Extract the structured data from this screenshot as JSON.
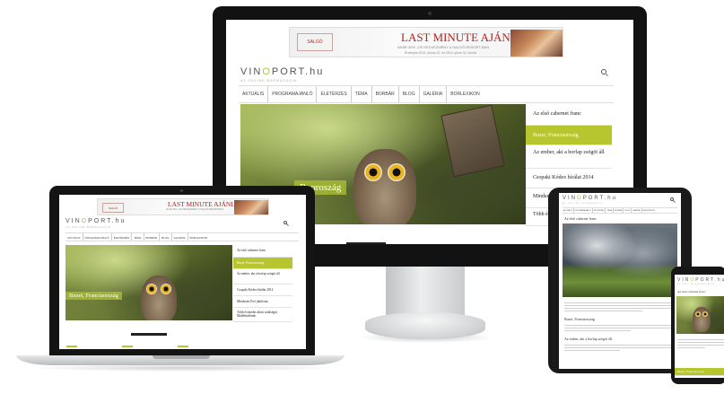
{
  "site": {
    "logo_left": "VIN",
    "logo_o": "O",
    "logo_right": "PORT.hu",
    "tagline": "AZ ONLINE BORMAGAZIN",
    "brand_color": "#b7c52e"
  },
  "banner": {
    "title": "LAST MINUTE AJÁNLAT",
    "subtitle": "AKÁR 30% -OS KEDVEZMÉNY A SALGÓ RESORT-BAN",
    "small": "Érvényes 2014. június 20. és 2014. július 31. között",
    "logo_text": "SALGÓ RESORT"
  },
  "nav": [
    "AKTUÁLIS",
    "PROGRAMAJÁNLÓ",
    "ÉLETÉRZÉS",
    "TÉMA",
    "BORBÁR",
    "BLOG",
    "GALÉRIA",
    "BORLEXIKON"
  ],
  "sidebar": [
    "Az elsõ cabernet franc",
    "Buzet, Franciaország",
    "Az ember, aki a borfap számított",
    "Csopaki Kódex bírálat 2014",
    "Mindenki..."
  ],
  "imac_sidebar": [
    "Az elsõ cabernet franc",
    "Buzet, Franciaország",
    "Az ember, aki a borfap zsögöt áll",
    "Csopaki Kódex bírálat 2014",
    "Mindszen",
    "Több év... szüksé..."
  ],
  "laptop_sidebar": [
    "Az elsõ cabernet franc",
    "Buzet, Franciaország",
    "Az ember, aki a borfap szögöt áll",
    "Csopaki Kódex bírálat 2014",
    "Mindszen Feri jubileum",
    "Több évtizedes álom szükséges Mádéfürdőnek"
  ],
  "hero_caption_imac": "Baoroszág",
  "hero_caption_laptop": "Buzet, Franciaország",
  "tablet": {
    "article_title": "Az elsõ cabernet franc",
    "section2": "Buzet, Franciaország",
    "section3": "Az ember, aki a borfap szögöt áll"
  },
  "phone": {
    "article_title": "Az elsõ cabernet franc",
    "section2": "Buzet, Franciaország"
  }
}
